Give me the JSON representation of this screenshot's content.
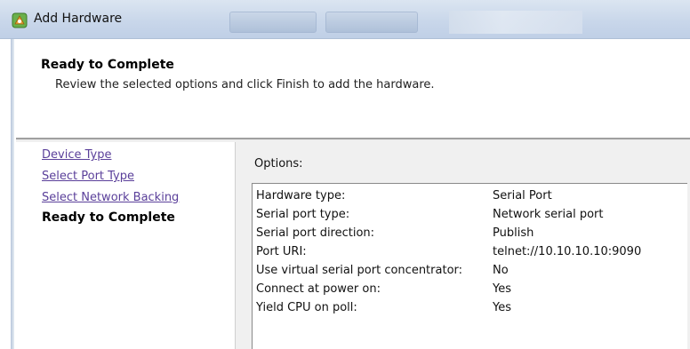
{
  "window": {
    "title": "Add Hardware",
    "icon": "vsphere-hardware-icon"
  },
  "header": {
    "title": "Ready to Complete",
    "subtitle": "Review the selected options and click Finish to add the hardware."
  },
  "nav": {
    "items": [
      {
        "label": "Device Type",
        "state": "link"
      },
      {
        "label": "Select Port Type",
        "state": "link"
      },
      {
        "label": "Select Network Backing",
        "state": "link"
      },
      {
        "label": "Ready to Complete",
        "state": "current"
      }
    ]
  },
  "options": {
    "label": "Options:",
    "rows": [
      {
        "key": "Hardware type:",
        "value": "Serial Port"
      },
      {
        "key": "Serial port type:",
        "value": "Network serial port"
      },
      {
        "key": "Serial port direction:",
        "value": "Publish"
      },
      {
        "key": "Port URI:",
        "value": "telnet://10.10.10.10:9090"
      },
      {
        "key": "Use virtual serial port concentrator:",
        "value": "No"
      },
      {
        "key": "Connect at power on:",
        "value": "Yes"
      },
      {
        "key": "Yield CPU on poll:",
        "value": "Yes"
      }
    ]
  },
  "colors": {
    "link": "#5a3f9a",
    "titlebar": "#c9d7ea",
    "icon_green": "#6ab04c",
    "icon_orange": "#e8a23a"
  }
}
